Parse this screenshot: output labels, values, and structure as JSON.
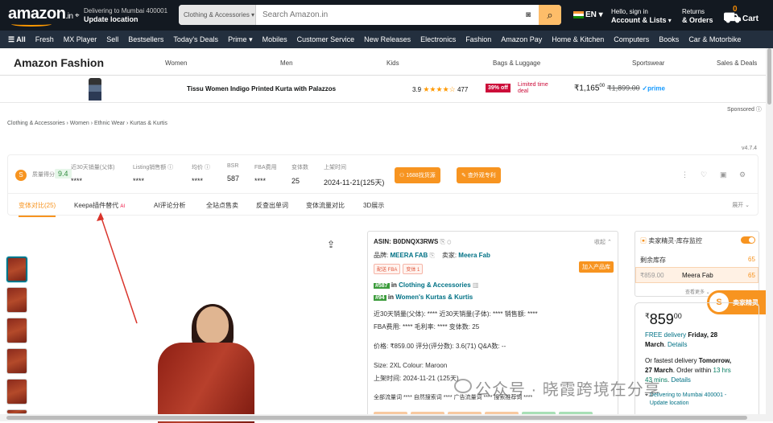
{
  "header": {
    "logo": "amazon",
    "logo_suffix": ".in",
    "deliver_line1": "Delivering to Mumbai 400001",
    "deliver_line2": "Update location",
    "search_category": "Clothing & Accessories",
    "search_placeholder": "Search Amazon.in",
    "lang": "EN",
    "account_line1": "Hello, sign in",
    "account_line2": "Account & Lists",
    "returns_line1": "Returns",
    "returns_line2": "& Orders",
    "cart_count": "0",
    "cart_label": "Cart"
  },
  "subnav": [
    "All",
    "Fresh",
    "MX Player",
    "Sell",
    "Bestsellers",
    "Today's Deals",
    "Prime",
    "Mobiles",
    "Customer Service",
    "New Releases",
    "Electronics",
    "Fashion",
    "Amazon Pay",
    "Home & Kitchen",
    "Computers",
    "Books",
    "Car & Motorbike"
  ],
  "fashion": {
    "title": "Amazon Fashion",
    "categories": [
      "Women",
      "Men",
      "Kids",
      "Bags & Luggage",
      "Sportswear",
      "Sales & Deals"
    ]
  },
  "sponsored": {
    "title": "Tissu Women Indigo Printed Kurta with Palazzos",
    "rating": "3.9",
    "stars": "★★★★☆",
    "reviews": "477",
    "discount": "39% off",
    "limited_line1": "Limited time",
    "limited_line2": "deal",
    "price": "₹1,165",
    "price_sup": "00",
    "mrp": "₹1,899.00",
    "prime": "✓prime",
    "sponsored_label": "Sponsored ⓘ"
  },
  "breadcrumb": "Clothing & Accessories › Women › Ethnic Wear › Kurtas & Kurtis",
  "version": "v4.7.4",
  "plugin": {
    "logo": "S",
    "metrics": [
      {
        "label": "质量得分",
        "value": "9.4"
      },
      {
        "label": "近30天销量(父体)",
        "value": "****"
      },
      {
        "label": "Listing销售额 ⓘ",
        "value": "****"
      },
      {
        "label": "均价 ⓘ",
        "value": "****"
      },
      {
        "label": "BSR",
        "value": "587"
      },
      {
        "label": "FBA费用",
        "value": "****"
      },
      {
        "label": "变体数",
        "value": "25"
      },
      {
        "label": "上架时间",
        "value": "2024-11-21(125天)"
      }
    ],
    "btn1": "1688找货源",
    "btn2": "查外观专利",
    "tabs": [
      "变体对比(25)",
      "Keepa插件替代",
      "AI评论分析",
      "全站点售卖",
      "反查出单词",
      "变体流量对比",
      "3D展示"
    ],
    "ai_badge": "AI",
    "expand": "展开 ⌄"
  },
  "info": {
    "asin": "ASIN: B0DNQX3RWS",
    "collapse": "收起 ⌃",
    "brand_label": "品牌:",
    "brand": "MEERA FAB",
    "seller_label": "卖家:",
    "seller": "Meera Fab",
    "tags": [
      "配送 FBA",
      "变体 1"
    ],
    "add_btn": "加入产品库",
    "rank1": "#587",
    "rank1_cat": "Clothing & Accessories",
    "rank2": "#94",
    "rank2_cat": "Women's Kurtas & Kurtis",
    "in": "in",
    "line_sales": "近30天销量(父体): ****    近30天销量(子体): ****    销售额: ****",
    "line_fba": "FBA费用: ****    毛利率: ****    变体数: 25",
    "line_price": "价格: ₹859.00    评分(评分数): 3.6(71)    Q&A数: --",
    "size": "Size: 2XL    Colour: Maroon",
    "listed": "上架时间: 2024-11-21 (125天)",
    "traffic": "全部流量词 ****    自然搜索词 ****    广告流量词 ****    搜索推荐词 ****"
  },
  "side": {
    "header": "卖家精灵·库存监控",
    "stock_label": "剩余库存",
    "stock_value": "65",
    "row_price": "₹859.00",
    "row_seller": "Meera Fab",
    "row_qty": "65",
    "view_more": "查看更多 ⌄",
    "float_label": "卖家精灵",
    "float_icon": "S"
  },
  "buybox": {
    "currency": "₹",
    "price": "859",
    "price_sup": "00",
    "free_delivery": "FREE delivery",
    "free_date": "Friday, 28",
    "free_date2": "March",
    "details": "Details",
    "fastest": "Or fastest delivery",
    "fastest_date": "Tomorrow,",
    "fastest_date2": "27 March",
    "order_within": ". Order within",
    "time_left": "13 hrs",
    "time_left2": "43 mins",
    "details2": "Details",
    "deliver_to": "Delivering to Mumbai 400001 -",
    "update": "Update location"
  },
  "watermark": "公众号 · 晓霞跨境在分享",
  "colors": {
    "amazon_dark": "#131921",
    "accent": "#f79420",
    "link": "#007185"
  }
}
